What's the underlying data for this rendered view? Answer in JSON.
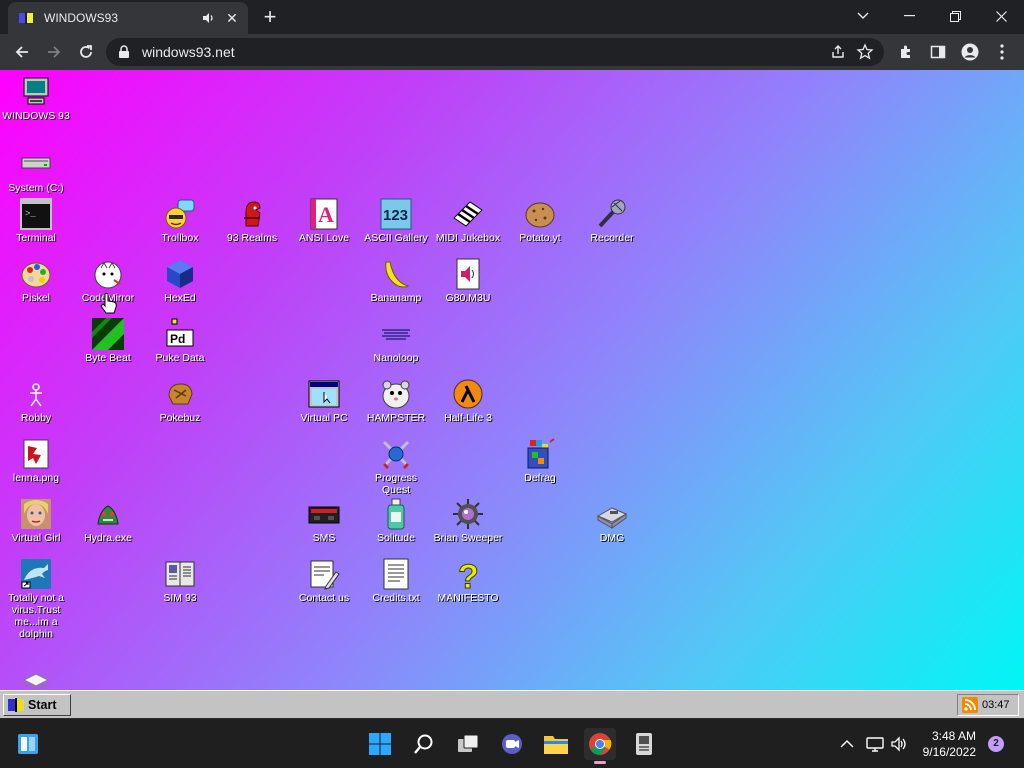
{
  "browser": {
    "tab_title": "WINDOWS93",
    "url": "windows93.net",
    "new_tab_label": "+"
  },
  "desktop_icons": [
    {
      "label": "WINDOWS 93",
      "icon": "computer-icon"
    },
    {
      "label": "System (C:)",
      "icon": "drive-icon"
    },
    {
      "label": "Terminal",
      "icon": "terminal-icon"
    },
    {
      "label": "Piskel",
      "icon": "palette-icon"
    },
    {
      "label": "CodeMirror",
      "icon": "cat-icon"
    },
    {
      "label": "Byte Beat",
      "icon": "bytebeat-icon"
    },
    {
      "label": "Robby",
      "icon": "stickman-icon"
    },
    {
      "label": "lenna.png",
      "icon": "image-icon"
    },
    {
      "label": "Virtual Girl",
      "icon": "face-icon"
    },
    {
      "label": "Totally not a virus.Trust me...im a dolphin",
      "icon": "dolphin-icon"
    },
    {
      "label": "Trollbox",
      "icon": "trollbox-icon"
    },
    {
      "label": "HexEd",
      "icon": "cube-icon"
    },
    {
      "label": "Puke Data",
      "icon": "puredata-icon"
    },
    {
      "label": "Pokebuz",
      "icon": "pokeball-icon"
    },
    {
      "label": "Hydra.exe",
      "icon": "hydra-icon"
    },
    {
      "label": "SIM 93",
      "icon": "book-icon"
    },
    {
      "label": "93 Realms",
      "icon": "realms-icon"
    },
    {
      "label": "ANSI Love",
      "icon": "ansi-icon"
    },
    {
      "label": "Virtual PC",
      "icon": "window-icon"
    },
    {
      "label": "SMS",
      "icon": "console-icon"
    },
    {
      "label": "Contact us",
      "icon": "contact-icon"
    },
    {
      "label": "ASCII Gallery",
      "icon": "ascii-icon"
    },
    {
      "label": "Bananamp",
      "icon": "banana-icon"
    },
    {
      "label": "Nanoloop",
      "icon": "wave-icon"
    },
    {
      "label": "HAMPSTER",
      "icon": "hamster-icon"
    },
    {
      "label": "Progress Quest",
      "icon": "swords-icon"
    },
    {
      "label": "Solitude",
      "icon": "bottle-icon"
    },
    {
      "label": "Credits.txt",
      "icon": "text-file-icon"
    },
    {
      "label": "MIDI Jukebox",
      "icon": "piano-icon"
    },
    {
      "label": "G80.M3U",
      "icon": "audio-file-icon"
    },
    {
      "label": "Half-Life 3",
      "icon": "halflife-icon"
    },
    {
      "label": "Brian Sweeper",
      "icon": "mine-icon"
    },
    {
      "label": "MANIFESTO",
      "icon": "question-icon"
    },
    {
      "label": "Potato.yt",
      "icon": "potato-icon"
    },
    {
      "label": "Defrag",
      "icon": "defrag-icon"
    },
    {
      "label": "Recorder",
      "icon": "microphone-icon"
    },
    {
      "label": "DMG",
      "icon": "floppy-icon"
    }
  ],
  "w93_taskbar": {
    "start_label": "Start",
    "tray_time": "03:47"
  },
  "os_taskbar": {
    "time": "3:48 AM",
    "date": "9/16/2022",
    "notification_count": "2"
  },
  "colors": {
    "desktop_gradient": [
      "#ff00ff",
      "#00f6f6"
    ],
    "chrome_frame": "#202124",
    "chrome_toolbar": "#35363a"
  }
}
